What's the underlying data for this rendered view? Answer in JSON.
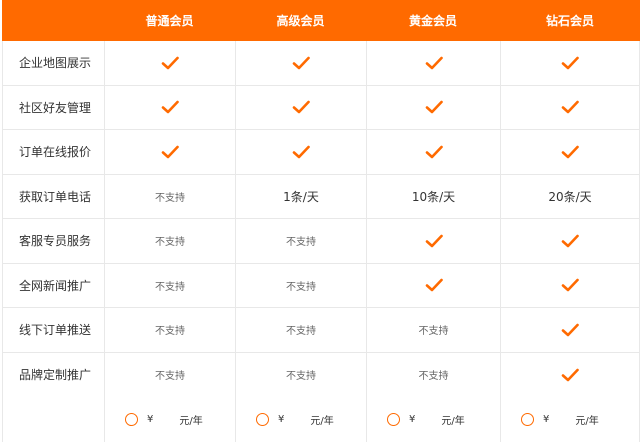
{
  "colors": {
    "accent": "#ff6a00",
    "border": "#e8e8e8",
    "text": "#333333"
  },
  "header": {
    "plans": [
      "普通会员",
      "高级会员",
      "黄金会员",
      "钻石会员"
    ]
  },
  "rows": [
    {
      "feature": "企业地图展示",
      "cells": [
        {
          "type": "check"
        },
        {
          "type": "check"
        },
        {
          "type": "check"
        },
        {
          "type": "check"
        }
      ]
    },
    {
      "feature": "社区好友管理",
      "cells": [
        {
          "type": "check"
        },
        {
          "type": "check"
        },
        {
          "type": "check"
        },
        {
          "type": "check"
        }
      ]
    },
    {
      "feature": "订单在线报价",
      "cells": [
        {
          "type": "check"
        },
        {
          "type": "check"
        },
        {
          "type": "check"
        },
        {
          "type": "check"
        }
      ]
    },
    {
      "feature": "获取订单电话",
      "cells": [
        {
          "type": "na",
          "text": "不支持"
        },
        {
          "type": "text",
          "text": "1条/天"
        },
        {
          "type": "text",
          "text": "10条/天"
        },
        {
          "type": "text",
          "text": "20条/天"
        }
      ]
    },
    {
      "feature": "客服专员服务",
      "cells": [
        {
          "type": "na",
          "text": "不支持"
        },
        {
          "type": "na",
          "text": "不支持"
        },
        {
          "type": "check"
        },
        {
          "type": "check"
        }
      ]
    },
    {
      "feature": "全网新闻推广",
      "cells": [
        {
          "type": "na",
          "text": "不支持"
        },
        {
          "type": "na",
          "text": "不支持"
        },
        {
          "type": "check"
        },
        {
          "type": "check"
        }
      ]
    },
    {
      "feature": "线下订单推送",
      "cells": [
        {
          "type": "na",
          "text": "不支持"
        },
        {
          "type": "na",
          "text": "不支持"
        },
        {
          "type": "na",
          "text": "不支持"
        },
        {
          "type": "check"
        }
      ]
    },
    {
      "feature": "品牌定制推广",
      "cells": [
        {
          "type": "na",
          "text": "不支持"
        },
        {
          "type": "na",
          "text": "不支持"
        },
        {
          "type": "na",
          "text": "不支持"
        },
        {
          "type": "check"
        }
      ]
    }
  ],
  "price": {
    "currency": "¥",
    "unit": "元/年",
    "options": [
      {
        "selected": false
      },
      {
        "selected": false
      },
      {
        "selected": false
      },
      {
        "selected": false
      }
    ]
  },
  "icons": {
    "check": "checkmark-icon",
    "radio": "radio-icon"
  }
}
